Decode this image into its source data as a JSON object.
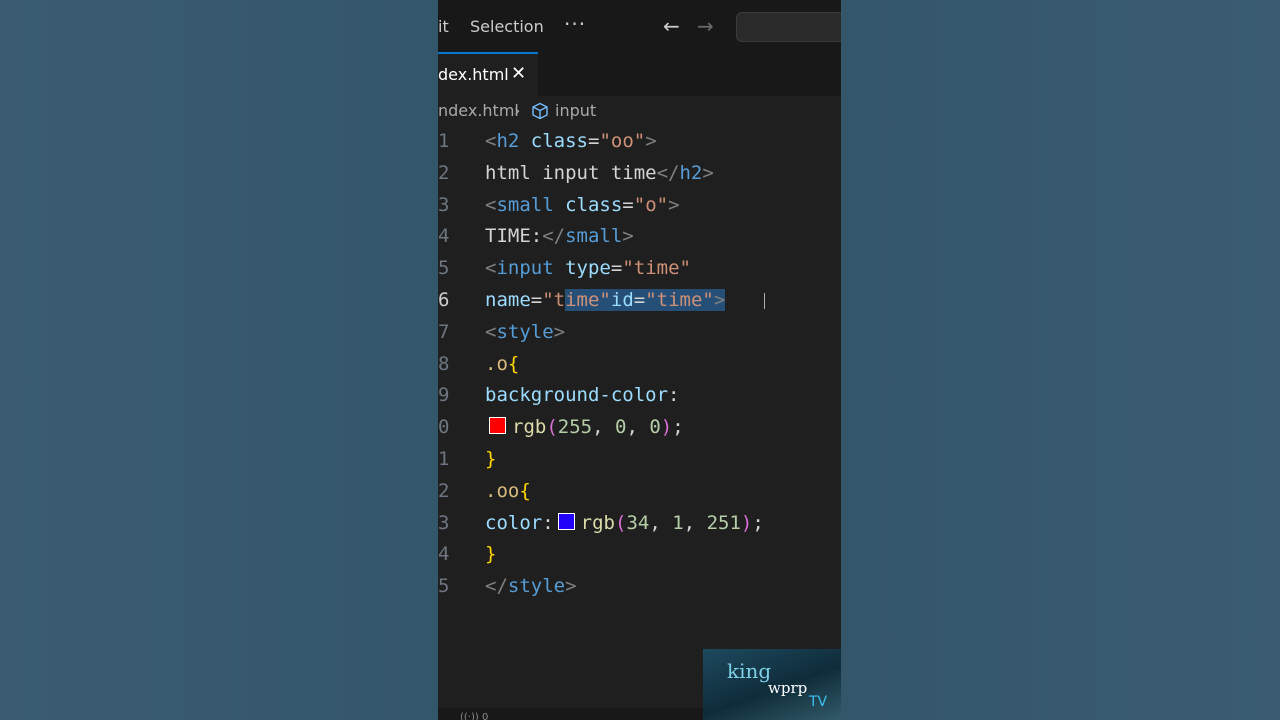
{
  "menu": {
    "edit_fragment": "it",
    "selection": "Selection",
    "more": "···"
  },
  "nav": {
    "back": "←",
    "forward": "→"
  },
  "tab": {
    "label": "dex.html",
    "close": "✕"
  },
  "breadcrumb": {
    "file": "ndex.html",
    "separator": "›",
    "symbol": "input"
  },
  "code": {
    "line_numbers": [
      "1",
      "2",
      "3",
      "4",
      "5",
      "6",
      "7",
      "8",
      "9",
      "0",
      "1",
      "2",
      "3",
      "4",
      "5"
    ],
    "active_line": "6",
    "lines": [
      [
        [
          "<",
          "tag"
        ],
        [
          "h2",
          "el"
        ],
        [
          " class",
          "attr"
        ],
        [
          "=",
          "plain"
        ],
        [
          "\"oo\"",
          "str"
        ],
        [
          ">",
          "tag"
        ]
      ],
      [
        [
          "html input time",
          "plain"
        ],
        [
          "</",
          "tag"
        ],
        [
          "h2",
          "el"
        ],
        [
          ">",
          "tag"
        ]
      ],
      [
        [
          "<",
          "tag"
        ],
        [
          "small",
          "el"
        ],
        [
          " class",
          "attr"
        ],
        [
          "=",
          "plain"
        ],
        [
          "\"o\"",
          "str"
        ],
        [
          ">",
          "tag"
        ]
      ],
      [
        [
          "TIME:",
          "plain"
        ],
        [
          "</",
          "tag"
        ],
        [
          "small",
          "el"
        ],
        [
          ">",
          "tag"
        ]
      ],
      [
        [
          "<",
          "tag"
        ],
        [
          "input",
          "el"
        ],
        [
          " type",
          "attr"
        ],
        [
          "=",
          "plain"
        ],
        [
          "\"time\"",
          "str"
        ]
      ],
      [
        [
          "name",
          "attr"
        ],
        [
          "=",
          "plain"
        ],
        [
          "\"t",
          "str"
        ],
        [
          "ime\"",
          "str",
          "hl"
        ],
        [
          "id",
          "attr",
          "hl"
        ],
        [
          "=",
          "plain",
          "hl"
        ],
        [
          "\"time\"",
          "str",
          "hl"
        ],
        [
          ">",
          "tag",
          "hl"
        ]
      ],
      [
        [
          "<",
          "tag"
        ],
        [
          "style",
          "el"
        ],
        [
          ">",
          "tag"
        ]
      ],
      [
        [
          ".o",
          "sel"
        ],
        [
          "{",
          "brace"
        ]
      ],
      [
        [
          "background-color",
          "attr"
        ],
        [
          ":",
          "plain"
        ]
      ],
      [
        [
          "#swatch-red",
          "swatch"
        ],
        [
          "rgb",
          "fn"
        ],
        [
          "(",
          "paren"
        ],
        [
          "255",
          "num"
        ],
        [
          ", ",
          "plain"
        ],
        [
          "0",
          "num"
        ],
        [
          ", ",
          "plain"
        ],
        [
          "0",
          "num"
        ],
        [
          ")",
          "paren"
        ],
        [
          ";",
          "plain"
        ]
      ],
      [
        [
          "}",
          "brace"
        ]
      ],
      [
        [
          ".oo",
          "sel"
        ],
        [
          "{",
          "brace"
        ]
      ],
      [
        [
          "color",
          "attr"
        ],
        [
          ":",
          "plain"
        ],
        [
          "#swatch-blue",
          "swatch"
        ],
        [
          "rgb",
          "fn"
        ],
        [
          "(",
          "paren"
        ],
        [
          "34",
          "num"
        ],
        [
          ", ",
          "plain"
        ],
        [
          "1",
          "num"
        ],
        [
          ", ",
          "plain"
        ],
        [
          "251",
          "num"
        ],
        [
          ")",
          "paren"
        ],
        [
          ";",
          "plain"
        ]
      ],
      [
        [
          "}",
          "brace"
        ]
      ],
      [
        [
          "</",
          "tag"
        ],
        [
          "style",
          "el"
        ],
        [
          ">",
          "tag"
        ]
      ]
    ]
  },
  "swatches": {
    "#swatch-red": "#ff0000",
    "#swatch-blue": "#2201fb"
  },
  "colors": {
    "accent": "#0078d4",
    "editor_bg": "#1f1f1f",
    "selection": "#264f78"
  },
  "status": {
    "fragment": "((·)) 0"
  },
  "watermark": {
    "line1": "king",
    "line2": "wprp",
    "line3": "TV"
  }
}
